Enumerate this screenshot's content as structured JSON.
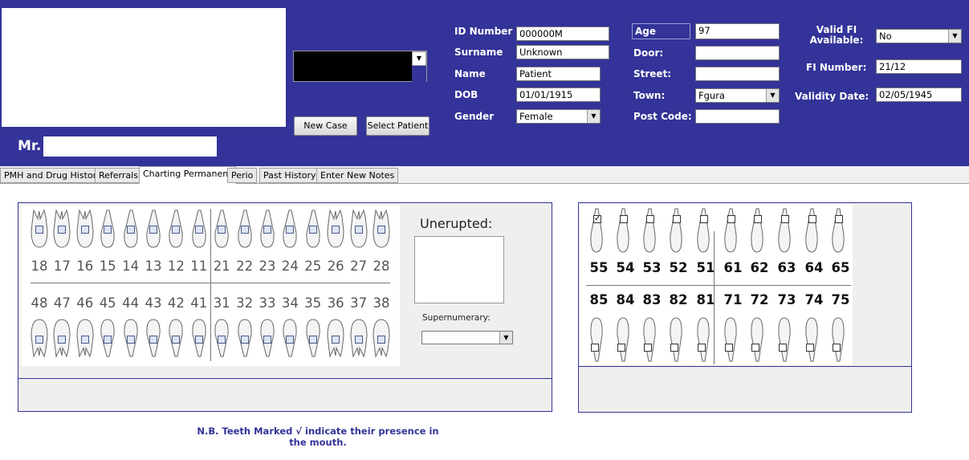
{
  "patient": {
    "salutation": "Mr.",
    "id_label": "ID Number",
    "id_value": "000000M",
    "surname_label": "Surname",
    "surname_value": "Unknown",
    "name_label": "Name",
    "name_value": "Patient",
    "dob_label": "DOB",
    "dob_value": "01/01/1915",
    "gender_label": "Gender",
    "gender_value": "Female",
    "age_label": "Age",
    "age_value": "97",
    "door_label": "Door:",
    "door_value": "",
    "street_label": "Street:",
    "street_value": "",
    "town_label": "Town:",
    "town_value": "Fgura",
    "postcode_label": "Post Code:",
    "postcode_value": "",
    "validfi_label": "Valid FI Available:",
    "validfi_value": "No",
    "finumber_label": "FI Number:",
    "finumber_value": "21/12",
    "validity_label": "Validity Date:",
    "validity_value": "02/05/1945"
  },
  "buttons": {
    "new_case": "New Case",
    "select_patient": "Select Patient"
  },
  "tabs": [
    {
      "label": "PMH and Drug History"
    },
    {
      "label": "Referrals"
    },
    {
      "label": "Charting Permanent",
      "active": true
    },
    {
      "label": "Perio"
    },
    {
      "label": "Past History"
    },
    {
      "label": "Enter New Notes"
    }
  ],
  "permanent": {
    "upper": [
      "18",
      "17",
      "16",
      "15",
      "14",
      "13",
      "12",
      "11",
      "21",
      "22",
      "23",
      "24",
      "25",
      "26",
      "27",
      "28"
    ],
    "lower": [
      "48",
      "47",
      "46",
      "45",
      "44",
      "43",
      "42",
      "41",
      "31",
      "32",
      "33",
      "34",
      "35",
      "36",
      "37",
      "38"
    ]
  },
  "unerupted": {
    "label": "Unerupted:",
    "supernumerary_label": "Supernumerary:",
    "supernumerary_value": ""
  },
  "deciduous": {
    "upper": [
      "55",
      "54",
      "53",
      "52",
      "51",
      "61",
      "62",
      "63",
      "64",
      "65"
    ],
    "lower": [
      "85",
      "84",
      "83",
      "82",
      "81",
      "71",
      "72",
      "73",
      "74",
      "75"
    ],
    "upper_checked": [
      true,
      false,
      false,
      false,
      false,
      false,
      false,
      false,
      false,
      false
    ],
    "lower_checked": [
      false,
      false,
      false,
      false,
      false,
      false,
      false,
      false,
      false,
      false
    ]
  },
  "note": "N.B. Teeth Marked √  indicate their presence in the mouth.",
  "colors": {
    "header": "#333399",
    "panel_border": "#333399"
  }
}
